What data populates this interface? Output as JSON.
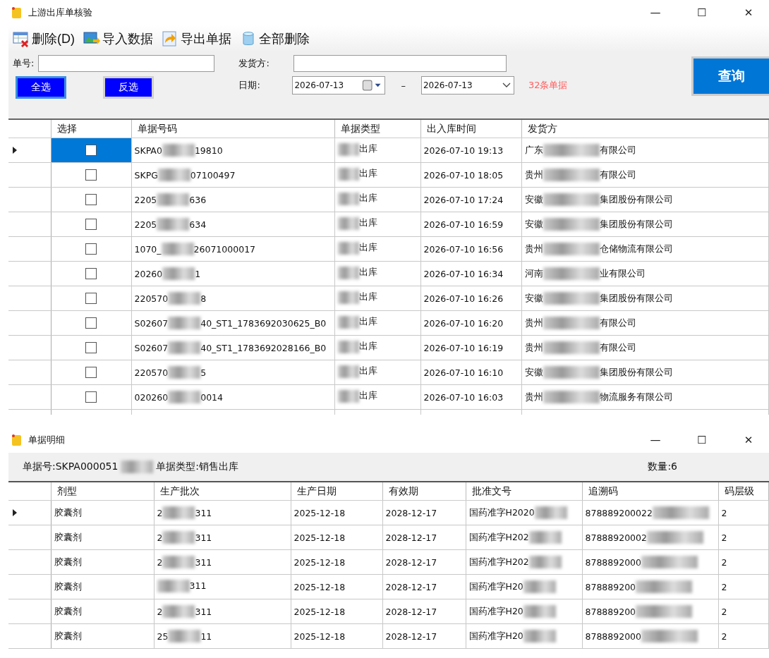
{
  "main_window": {
    "title": "上游出库单核验",
    "controls": [
      "—",
      "☐",
      "✕"
    ]
  },
  "toolbar": [
    {
      "kind": "delete",
      "label": "删除(D)"
    },
    {
      "kind": "import",
      "label": "导入数据"
    },
    {
      "kind": "export",
      "label": "导出单据"
    },
    {
      "kind": "clear",
      "label": "全部删除"
    }
  ],
  "filters": {
    "number_label": "单号:",
    "shipper_label": "发货方:",
    "date_label": "日期:",
    "date_from": "2026-07-13",
    "date_sep": "–",
    "date_to": "2026-07-13",
    "count": "32条单据",
    "select_all": "全选",
    "invert": "反选",
    "query": "查询"
  },
  "grid": {
    "columns": [
      "选择",
      "单据号码",
      "单据类型",
      "出入库时间",
      "发货方"
    ],
    "rows": [
      {
        "selected": true,
        "checked": false,
        "number_start": "SKPA0",
        "number_end": "19810",
        "type_end": "出库",
        "time": "2026-07-10 19:13",
        "shipper_start": "广东",
        "shipper_end": "有限公司"
      },
      {
        "selected": false,
        "checked": false,
        "number_start": "SKPG",
        "number_end": "07100497",
        "type_end": "出库",
        "time": "2026-07-10 18:05",
        "shipper_start": "贵州",
        "shipper_end": "有限公司"
      },
      {
        "selected": false,
        "checked": false,
        "number_start": "2205",
        "number_end": "636",
        "type_end": "出库",
        "time": "2026-07-10 17:24",
        "shipper_start": "安徽",
        "shipper_end": "集团股份有限公司"
      },
      {
        "selected": false,
        "checked": false,
        "number_start": "2205",
        "number_end": "634",
        "type_end": "出库",
        "time": "2026-07-10 16:59",
        "shipper_start": "安徽",
        "shipper_end": "集团股份有限公司"
      },
      {
        "selected": false,
        "checked": false,
        "number_start": "1070_",
        "number_end": "26071000017",
        "type_end": "出库",
        "time": "2026-07-10 16:56",
        "shipper_start": "贵州",
        "shipper_end": "仓储物流有限公司"
      },
      {
        "selected": false,
        "checked": false,
        "number_start": "20260",
        "number_end": "1",
        "type_end": "出库",
        "time": "2026-07-10 16:34",
        "shipper_start": "河南",
        "shipper_end": "业有限公司"
      },
      {
        "selected": false,
        "checked": false,
        "number_start": "220570",
        "number_end": "8",
        "type_end": "出库",
        "time": "2026-07-10 16:26",
        "shipper_start": "安徽",
        "shipper_end": "集团股份有限公司"
      },
      {
        "selected": false,
        "checked": false,
        "number_start": "S02607",
        "number_end": "40_ST1_1783692030625_B0",
        "type_end": "出库",
        "time": "2026-07-10 16:20",
        "shipper_start": "贵州",
        "shipper_end": "有限公司"
      },
      {
        "selected": false,
        "checked": false,
        "number_start": "S02607",
        "number_end": "40_ST1_1783692028166_B0",
        "type_end": "出库",
        "time": "2026-07-10 16:19",
        "shipper_start": "贵州",
        "shipper_end": "有限公司"
      },
      {
        "selected": false,
        "checked": false,
        "number_start": "220570",
        "number_end": "5",
        "type_end": "出库",
        "time": "2026-07-10 16:10",
        "shipper_start": "安徽",
        "shipper_end": "集团股份有限公司"
      },
      {
        "selected": false,
        "checked": false,
        "number_start": "020260",
        "number_end": "0014",
        "type_end": "出库",
        "time": "2026-07-10 16:03",
        "shipper_start": "贵州",
        "shipper_end": "物流服务有限公司"
      }
    ]
  },
  "detail_window": {
    "title": "单据明细",
    "controls": [
      "—",
      "☐",
      "✕"
    ],
    "doc_number": "单据号:SKPA000051",
    "doc_type": "单据类型:销售出库",
    "quantity": "数量:6",
    "columns": [
      "剂型",
      "生产批次",
      "生产日期",
      "有效期",
      "批准文号",
      "追溯码",
      "码层级"
    ],
    "rows": [
      {
        "selected": true,
        "form": "胶囊剂",
        "batch_start": "2",
        "batch_end": "311",
        "made": "2025-12-18",
        "expiry": "2028-12-17",
        "approval": "国药准字H2020",
        "trace": "878889200022",
        "level_code": "2"
      },
      {
        "selected": false,
        "form": "胶囊剂",
        "batch_start": "2",
        "batch_end": "311",
        "made": "2025-12-18",
        "expiry": "2028-12-17",
        "approval": "国药准字H202",
        "trace": "87888920002",
        "level_code": "2"
      },
      {
        "selected": false,
        "form": "胶囊剂",
        "batch_start": "2",
        "batch_end": "311",
        "made": "2025-12-18",
        "expiry": "2028-12-17",
        "approval": "国药准字H202",
        "trace": "8788892000",
        "level_code": "2"
      },
      {
        "selected": false,
        "form": "胶囊剂",
        "batch_end": "311",
        "made": "2025-12-18",
        "expiry": "2028-12-17",
        "approval": "国药准字H20",
        "trace": "878889200",
        "level_code": "2"
      },
      {
        "selected": false,
        "form": "胶囊剂",
        "batch_start": "2",
        "batch_end": "311",
        "made": "2025-12-18",
        "expiry": "2028-12-17",
        "approval": "国药准字H20",
        "trace": "878889200",
        "level_code": "2"
      },
      {
        "selected": false,
        "form": "胶囊剂",
        "batch_start": "25",
        "batch_end": "11",
        "made": "2025-12-18",
        "expiry": "2028-12-17",
        "approval": "国药准字H20",
        "trace": "8788892000",
        "level_code": "2"
      }
    ]
  }
}
